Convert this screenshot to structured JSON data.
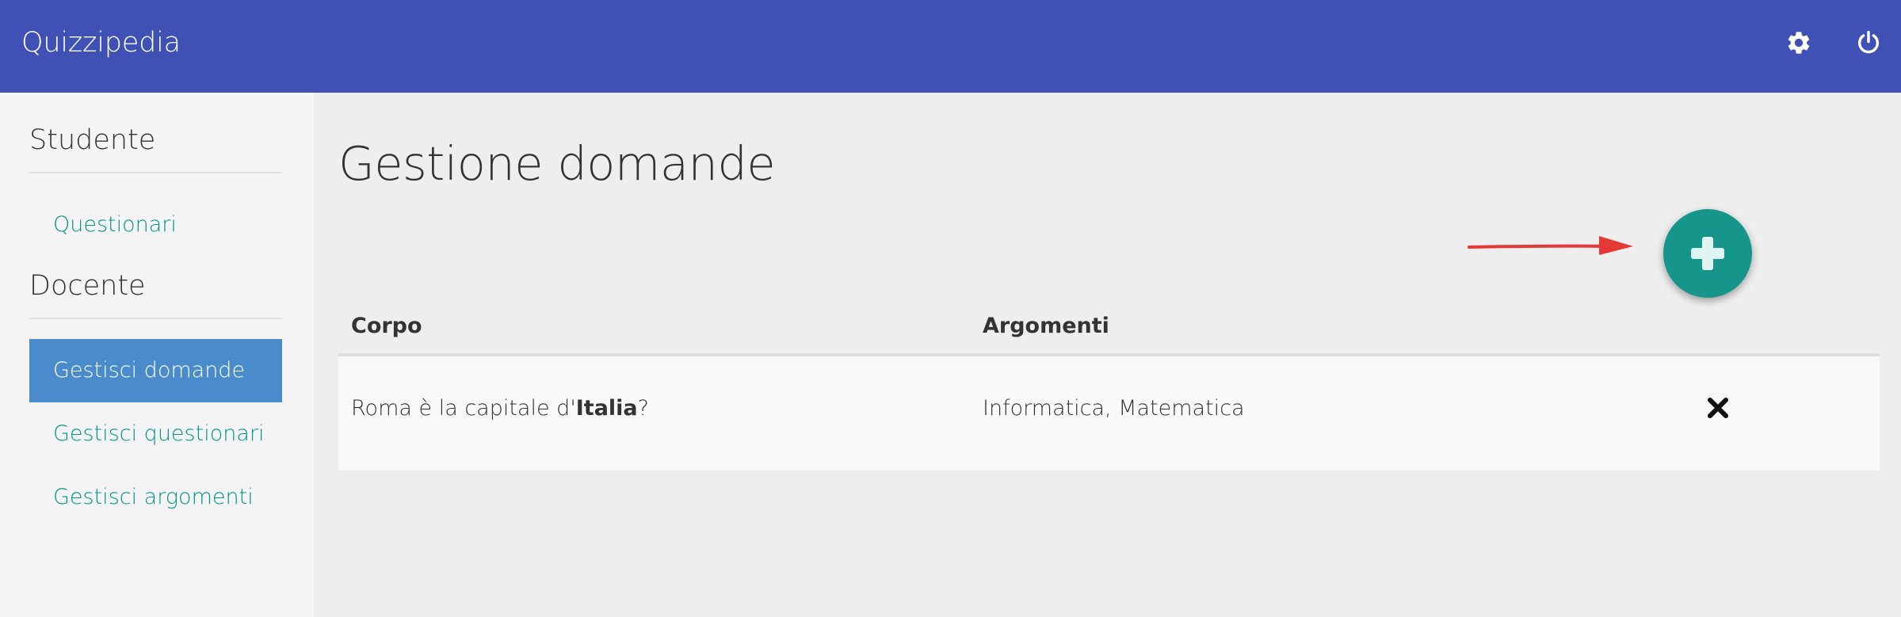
{
  "navbar": {
    "brand": "Quizzipedia",
    "icons": [
      "settings-gear-icon",
      "power-icon"
    ],
    "color": "#3f51b5"
  },
  "sidebar": {
    "sections": [
      {
        "heading": "Studente",
        "items": [
          {
            "label": "Questionari",
            "active": false
          }
        ]
      },
      {
        "heading": "Docente",
        "items": [
          {
            "label": "Gestisci domande",
            "active": true
          },
          {
            "label": "Gestisci questionari",
            "active": false
          },
          {
            "label": "Gestisci argomenti",
            "active": false
          }
        ]
      }
    ],
    "link_color": "#009688",
    "active_color": "#4a8ccb"
  },
  "main": {
    "title": "Gestione domande",
    "add_button": {
      "icon": "plus-icon",
      "color": "#16968a"
    },
    "annotation": {
      "icon": "red-arrow-icon",
      "color": "#e53935"
    },
    "table": {
      "headers": [
        "Corpo",
        "Argomenti"
      ],
      "rows": [
        {
          "corpo_prefix": "Roma è la capitale d'",
          "corpo_bold": "Italia",
          "corpo_suffix": "?",
          "argomenti": "Informatica, Matematica",
          "action_icon": "delete-x-icon"
        }
      ]
    }
  }
}
